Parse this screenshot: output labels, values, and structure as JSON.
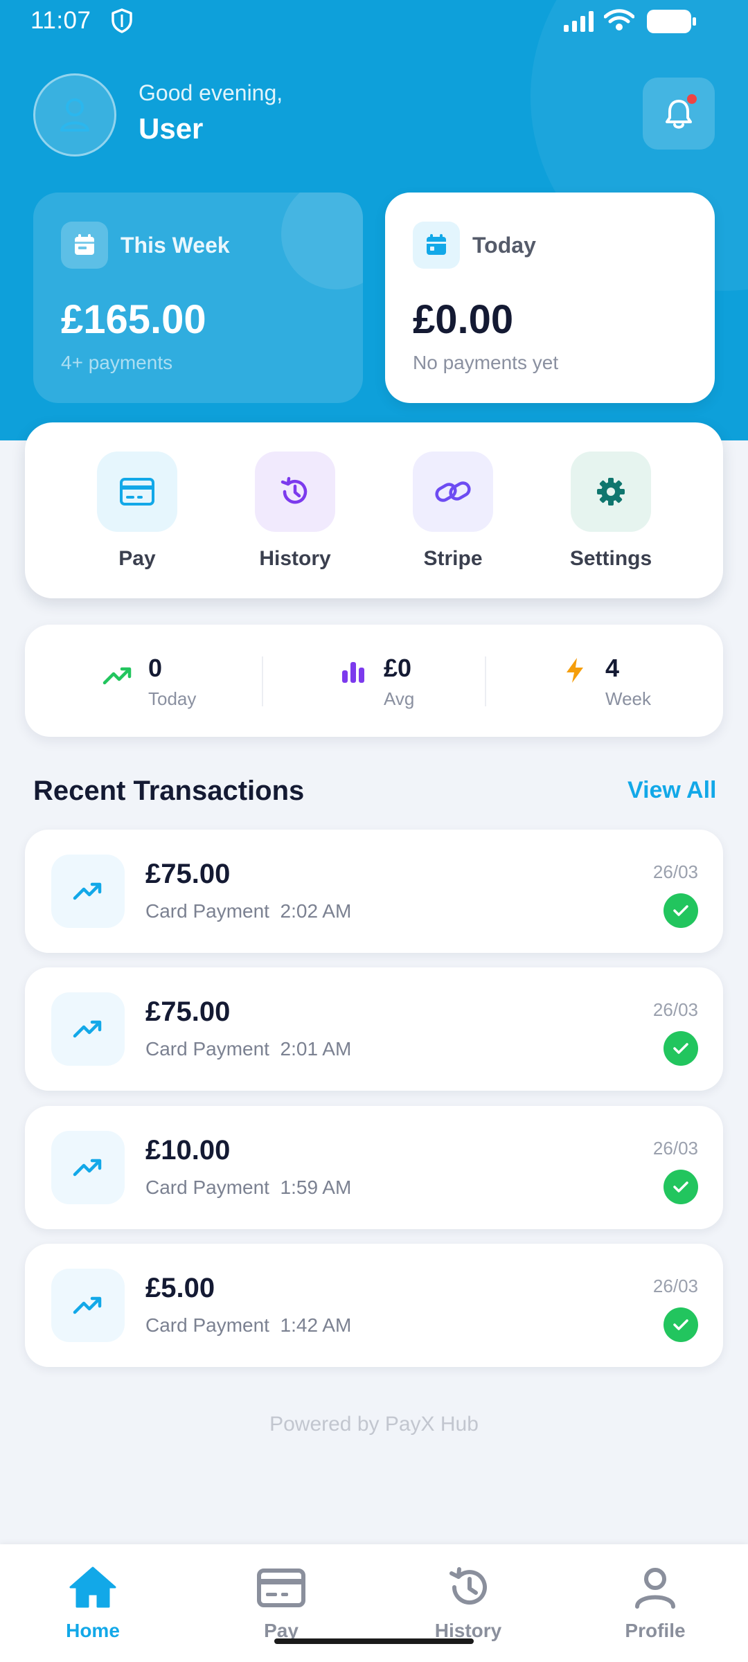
{
  "status_bar": {
    "time": "11:07"
  },
  "header": {
    "greeting": "Good evening,",
    "user_name": "User"
  },
  "summary": {
    "week": {
      "title": "This Week",
      "amount": "£165.00",
      "sub": "4+ payments"
    },
    "today": {
      "title": "Today",
      "amount": "£0.00",
      "sub": "No payments yet"
    }
  },
  "actions": [
    {
      "label": "Pay",
      "icon": "card-icon"
    },
    {
      "label": "History",
      "icon": "history-icon"
    },
    {
      "label": "Stripe",
      "icon": "link-icon"
    },
    {
      "label": "Settings",
      "icon": "gear-icon"
    }
  ],
  "stats": [
    {
      "value": "0",
      "label": "Today",
      "icon": "trending-up-icon"
    },
    {
      "value": "£0",
      "label": "Avg",
      "icon": "bar-chart-icon"
    },
    {
      "value": "4",
      "label": "Week",
      "icon": "lightning-icon"
    }
  ],
  "recent": {
    "title": "Recent Transactions",
    "view_all": "View All",
    "items": [
      {
        "amount": "£75.00",
        "method": "Card Payment",
        "time": "2:02 AM",
        "date": "26/03"
      },
      {
        "amount": "£75.00",
        "method": "Card Payment",
        "time": "2:01 AM",
        "date": "26/03"
      },
      {
        "amount": "£10.00",
        "method": "Card Payment",
        "time": "1:59 AM",
        "date": "26/03"
      },
      {
        "amount": "£5.00",
        "method": "Card Payment",
        "time": "1:42 AM",
        "date": "26/03"
      }
    ]
  },
  "footer": {
    "powered": "Powered by PayX Hub"
  },
  "nav": [
    {
      "label": "Home",
      "active": true
    },
    {
      "label": "Pay",
      "active": false
    },
    {
      "label": "History",
      "active": false
    },
    {
      "label": "Profile",
      "active": false
    }
  ],
  "colors": {
    "primary": "#0ea0da",
    "accent": "#12a8e8",
    "success": "#22c55e",
    "purple": "#7c3aed",
    "orange": "#f59e0b",
    "teal": "#0f766e"
  }
}
